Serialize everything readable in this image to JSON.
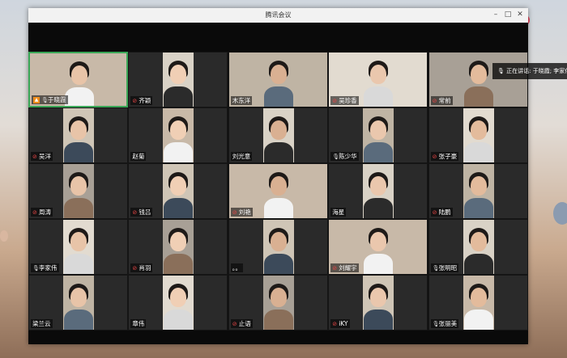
{
  "window": {
    "title": "腾讯会议"
  },
  "speaking": {
    "text": "正在讲话: 于晓霞; 李家伟"
  },
  "colors": {
    "speaking_border": "#3aa757",
    "host_badge": "#f08c1a",
    "mic_off": "#e64545"
  },
  "participants": [
    {
      "name": "于晓霞",
      "mic": "on",
      "host": true,
      "speaking": true
    },
    {
      "name": "齐颖",
      "mic": "off"
    },
    {
      "name": "木东洋",
      "mic": "none"
    },
    {
      "name": "吴珍香",
      "mic": "off"
    },
    {
      "name": "常前",
      "mic": "off"
    },
    {
      "name": "吴洋",
      "mic": "off"
    },
    {
      "name": "赵菊",
      "mic": "none"
    },
    {
      "name": "刘光意",
      "mic": "none"
    },
    {
      "name": "陈少华",
      "mic": "on"
    },
    {
      "name": "张子豪",
      "mic": "off"
    },
    {
      "name": "周涛",
      "mic": "off"
    },
    {
      "name": "钱吕",
      "mic": "off"
    },
    {
      "name": "刘艳",
      "mic": "off"
    },
    {
      "name": "海星",
      "mic": "none"
    },
    {
      "name": "陆鹏",
      "mic": "off"
    },
    {
      "name": "李家伟",
      "mic": "on"
    },
    {
      "name": "肖羽",
      "mic": "off"
    },
    {
      "name": "。。",
      "mic": "none"
    },
    {
      "name": "刘耀宇",
      "mic": "off"
    },
    {
      "name": "张明昭",
      "mic": "on"
    },
    {
      "name": "梁兰云",
      "mic": "none"
    },
    {
      "name": "章伟",
      "mic": "none"
    },
    {
      "name": "止语",
      "mic": "off"
    },
    {
      "name": "iKY",
      "mic": "off"
    },
    {
      "name": "张丽美",
      "mic": "on"
    }
  ]
}
